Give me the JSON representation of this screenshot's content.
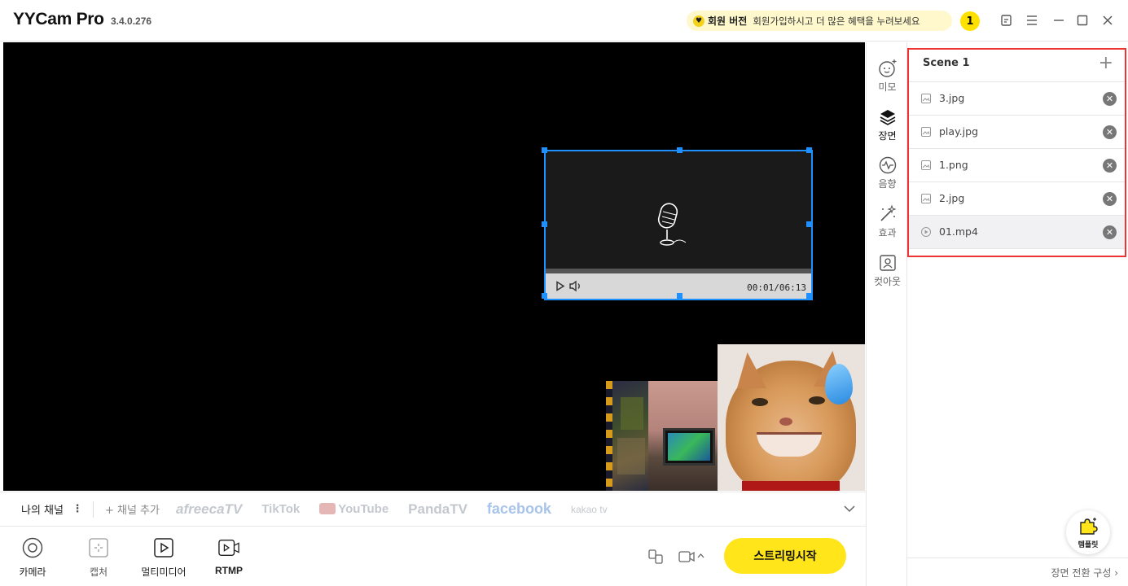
{
  "titlebar": {
    "app_name": "YYCam Pro",
    "version": "3.4.0.276",
    "member_label": "회원 버전",
    "promo_message": "회원가입하시고 더 많은 혜택을 누려보세요",
    "notification_count": "1"
  },
  "preview": {
    "video_time": "00:01/06:13"
  },
  "channels": {
    "my_channel": "나의 채널",
    "more": "⋮",
    "add_channel": "+ 채널 추가",
    "platforms": [
      "afreecaTV",
      "TikTok",
      "YouTube",
      "PandaTV",
      "facebook",
      "kakao tv"
    ]
  },
  "toolbar": {
    "camera": "카메라",
    "capture": "캡처",
    "multimedia": "멀티미디어",
    "rtmp": "RTMP",
    "start_streaming": "스트리밍시작"
  },
  "vtabs": {
    "memo": "미모",
    "scene": "장면",
    "audio": "음향",
    "effect": "효과",
    "cutout": "컷아웃"
  },
  "scene": {
    "title": "Scene 1",
    "add": "+",
    "sources": [
      {
        "name": "3.jpg",
        "type": "image"
      },
      {
        "name": "play.jpg",
        "type": "image"
      },
      {
        "name": "1.png",
        "type": "image"
      },
      {
        "name": "2.jpg",
        "type": "image"
      },
      {
        "name": "01.mp4",
        "type": "video"
      }
    ]
  },
  "template_label": "템플릿",
  "scene_transition": "장면 전환 구성 ›",
  "colors": {
    "accent_yellow": "#ffe51a",
    "selection_blue": "#1e90ff",
    "highlight_red": "#ee3333"
  }
}
